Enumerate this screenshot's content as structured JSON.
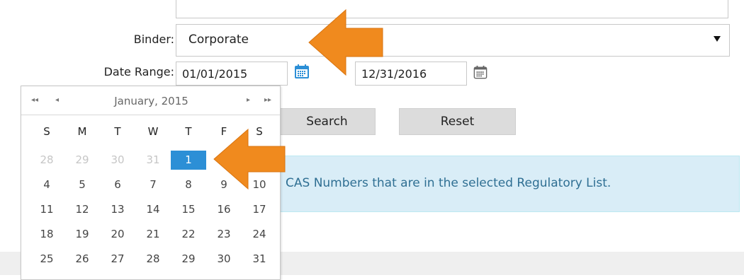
{
  "form": {
    "binder_label": "Binder:",
    "binder_value": "Corporate",
    "date_range_label": "Date Range:",
    "date_from": "01/01/2015",
    "date_to": "12/31/2016",
    "search_label": "Search",
    "reset_label": "Reset"
  },
  "info": {
    "message": "CAS Numbers that are in the selected Regulatory List."
  },
  "calendar": {
    "title": "January, 2015",
    "nav_prev_year": "◂◂",
    "nav_prev_month": "◂",
    "nav_next_month": "▸",
    "nav_next_year": "▸▸",
    "weekdays": [
      "S",
      "M",
      "T",
      "W",
      "T",
      "F",
      "S"
    ],
    "weeks": [
      [
        "28",
        "29",
        "30",
        "31",
        "1",
        "2",
        "3"
      ],
      [
        "4",
        "5",
        "6",
        "7",
        "8",
        "9",
        "10"
      ],
      [
        "11",
        "12",
        "13",
        "14",
        "15",
        "16",
        "17"
      ],
      [
        "18",
        "19",
        "20",
        "21",
        "22",
        "23",
        "24"
      ],
      [
        "25",
        "26",
        "27",
        "28",
        "29",
        "30",
        "31"
      ]
    ],
    "selected_day": "1"
  },
  "colors": {
    "selected_day": "#2c8fd6",
    "annotation_arrow": "#f08a1e",
    "info_bg": "#d9edf7"
  },
  "icons": [
    "calendar-icon",
    "dropdown-arrow-icon",
    "annotation-arrow-icon"
  ]
}
